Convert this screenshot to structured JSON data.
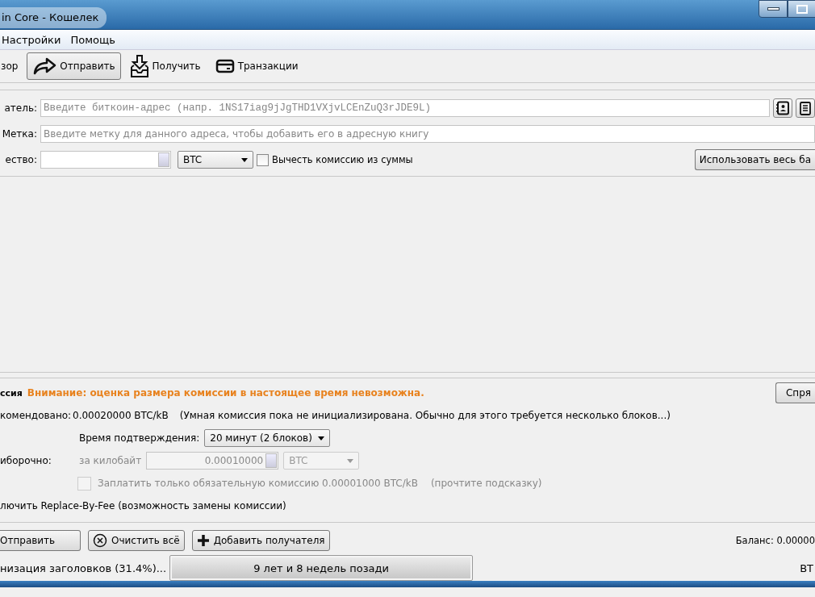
{
  "window": {
    "title": "in Core - Кошелек"
  },
  "menu": [
    {
      "label": "Настройки"
    },
    {
      "label": "Помощь"
    }
  ],
  "toolbar": [
    {
      "label": "зор",
      "selected": false
    },
    {
      "label": "Отправить",
      "selected": true
    },
    {
      "label": "Получить",
      "selected": false
    },
    {
      "label": "Транзакции",
      "selected": false
    }
  ],
  "recipient": {
    "pay_to_label": "атель:",
    "address_placeholder": "Введите биткоин-адрес (напр. 1NS17iag9jJgTHD1VXjvLCEnZuQ3rJDE9L)",
    "label_label": "Метка:",
    "label_placeholder": "Введите метку для данного адреса, чтобы добавить его в адресную книгу",
    "amount_label": "ество:",
    "unit": "BTC",
    "subtract_fee": {
      "label": "Вычесть комиссию из суммы",
      "checked": false
    },
    "use_balance_button": "Использовать весь ба"
  },
  "fee": {
    "title": "ссия",
    "warning": "Внимание: оценка размера комиссии в настоящее время невозможна.",
    "hide_button": "Спря",
    "recommended_label": "комендовано:",
    "recommended_value": "0.00020000 BTC/kB",
    "smart_fee_note": "(Умная комиссия пока не инициализирована. Обычно для этого требуется несколько блоков...)",
    "confirmation_label": "Время подтверждения:",
    "confirmation_value": "20 минут (2 блоков)",
    "custom_label": "иборочно:",
    "per_kb_label": "за килобайт",
    "custom_value": "0.00010000",
    "custom_unit": "BTC",
    "custom_disabled": true,
    "min_fee": {
      "label": "Заплатить только обязательную комиссию 0.00001000 BTC/kB",
      "checked": false,
      "disabled": true
    },
    "min_fee_hint": "(прочтите подсказку)",
    "rbf_label": "лючить Replace-By-Fee (возможность замены комиссии)"
  },
  "actions": [
    {
      "label": "Отправить"
    },
    {
      "label": "Очистить всё"
    },
    {
      "label": "Добавить получателя"
    }
  ],
  "balance": "Баланс: 0.00000",
  "status_bar": {
    "sync_text": "низация заголовков (31.4%)...",
    "progress": {
      "text": "9 лет и 8 недель позади",
      "level": 1
    },
    "unit": "BT"
  }
}
